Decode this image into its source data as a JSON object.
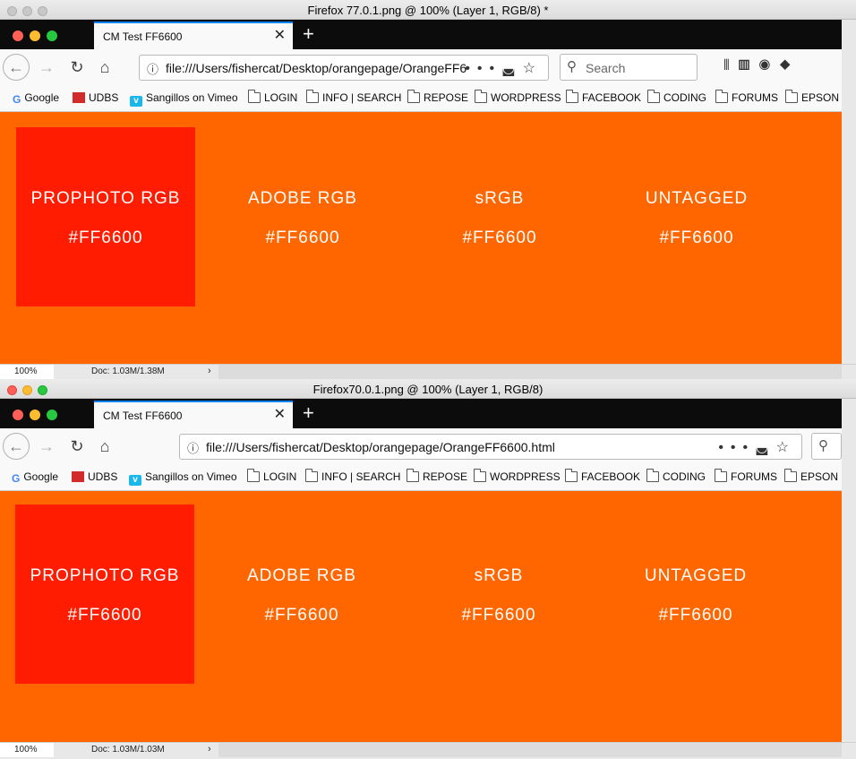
{
  "windows": [
    {
      "ps_title": "Firefox 77.0.1.png @ 100% (Layer 1, RGB/8) *",
      "tab_title": "CM Test FF6600",
      "new_tab_glyph": "+",
      "close_glyph": "✕",
      "url": "file:///Users/fishercat/Desktop/orangepage/OrangeFF6",
      "search_placeholder": "Search",
      "bookmarks": [
        "Google",
        "UDBS",
        "Sangillos on Vimeo",
        "LOGIN",
        "INFO | SEARCH",
        "REPOSE",
        "WORDPRESS",
        "FACEBOOK",
        "CODING",
        "FORUMS",
        "EPSON"
      ],
      "samples": [
        {
          "label": "PROPHOTO RGB",
          "hex": "#FF6600"
        },
        {
          "label": "ADOBE RGB",
          "hex": "#FF6600"
        },
        {
          "label": "sRGB",
          "hex": "#FF6600"
        },
        {
          "label": "UNTAGGED",
          "hex": "#FF6600"
        }
      ],
      "zoom": "100%",
      "doc": "Doc: 1.03M/1.38M",
      "arrow": "›"
    },
    {
      "ps_title": "Firefox70.0.1.png @ 100% (Layer 1, RGB/8)",
      "tab_title": "CM Test FF6600",
      "new_tab_glyph": "+",
      "close_glyph": "✕",
      "url": "file:///Users/fishercat/Desktop/orangepage/OrangeFF6600.html",
      "search_placeholder": "",
      "bookmarks": [
        "Google",
        "UDBS",
        "Sangillos on Vimeo",
        "LOGIN",
        "INFO | SEARCH",
        "REPOSE",
        "WORDPRESS",
        "FACEBOOK",
        "CODING",
        "FORUMS",
        "EPSON"
      ],
      "samples": [
        {
          "label": "PROPHOTO RGB",
          "hex": "#FF6600"
        },
        {
          "label": "ADOBE RGB",
          "hex": "#FF6600"
        },
        {
          "label": "sRGB",
          "hex": "#FF6600"
        },
        {
          "label": "UNTAGGED",
          "hex": "#FF6600"
        }
      ],
      "zoom": "100%",
      "doc": "Doc: 1.03M/1.03M",
      "arrow": "›"
    }
  ],
  "colors": {
    "page_background": "#ff6600",
    "prophoto_box": "#ff1c00",
    "tab_accent": "#0a84ff"
  },
  "icons": {
    "nav": [
      "back-arrow-icon",
      "forward-arrow-icon",
      "reload-icon",
      "home-icon"
    ],
    "url": [
      "info-icon",
      "page-actions-icon",
      "pocket-icon",
      "bookmark-star-icon"
    ],
    "toolbar": [
      "library-icon",
      "sidebar-icon",
      "account-icon",
      "extension-icon"
    ],
    "bookmarks": [
      "google-icon",
      "udbs-icon",
      "vimeo-icon",
      "folder-icon"
    ]
  }
}
